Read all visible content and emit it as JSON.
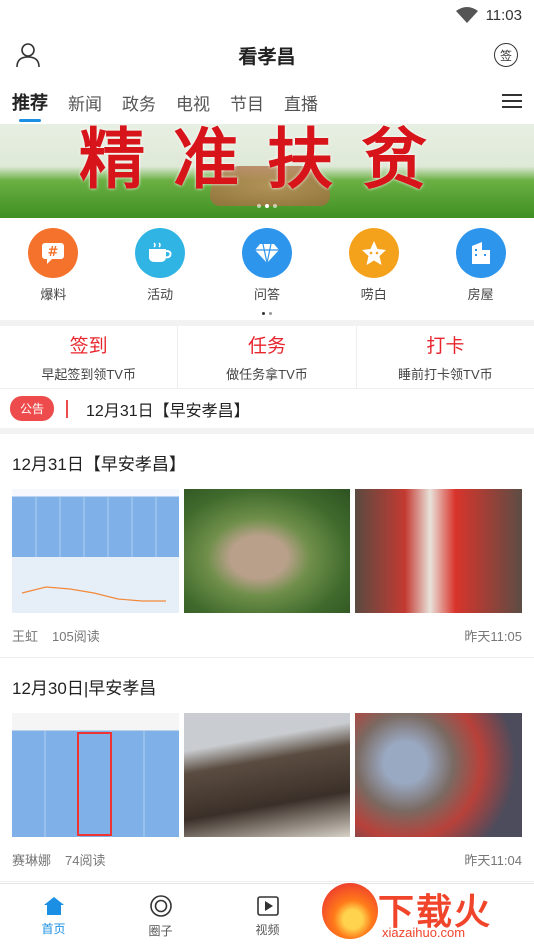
{
  "status": {
    "time": "11:03"
  },
  "header": {
    "title": "看孝昌",
    "sign_label": "签"
  },
  "tabs": [
    {
      "label": "推荐",
      "active": true
    },
    {
      "label": "新闻"
    },
    {
      "label": "政务"
    },
    {
      "label": "电视"
    },
    {
      "label": "节目"
    },
    {
      "label": "直播"
    }
  ],
  "banner": {
    "text": "精准扶贫"
  },
  "shortcuts": [
    {
      "label": "爆料",
      "icon": "hashtag-chat-icon",
      "glyph": "#",
      "color": "#f5722c"
    },
    {
      "label": "活动",
      "icon": "coffee-cup-icon",
      "glyph": "☕",
      "color": "#2fb4e4"
    },
    {
      "label": "问答",
      "icon": "diamond-icon",
      "glyph": "◆",
      "color": "#2e95ec"
    },
    {
      "label": "唠白",
      "icon": "star-face-icon",
      "glyph": "★",
      "color": "#f4a21c"
    },
    {
      "label": "房屋",
      "icon": "building-icon",
      "glyph": "▦",
      "color": "#2e95ec"
    }
  ],
  "tasks": [
    {
      "title": "签到",
      "sub": "早起签到领TV币"
    },
    {
      "title": "任务",
      "sub": "做任务拿TV币"
    },
    {
      "title": "打卡",
      "sub": "睡前打卡领TV币"
    }
  ],
  "notice": {
    "badge": "公告",
    "text": "12月31日【早安孝昌】"
  },
  "articles": [
    {
      "title": "12月31日【早安孝昌】",
      "author": "王虹",
      "reads": "105阅读",
      "time": "昨天11:05"
    },
    {
      "title": "12月30日|早安孝昌",
      "author": "赛琳娜",
      "reads": "74阅读",
      "time": "昨天11:04"
    }
  ],
  "tabbar": [
    {
      "label": "首页",
      "icon": "home-icon",
      "active": true
    },
    {
      "label": "圈子",
      "icon": "circle-icon"
    },
    {
      "label": "视频",
      "icon": "play-icon"
    }
  ],
  "watermark": {
    "text": "下载火",
    "url": "xiazaihuo.com"
  },
  "colors": {
    "accent": "#1a8fe3",
    "red": "#e8262e"
  }
}
